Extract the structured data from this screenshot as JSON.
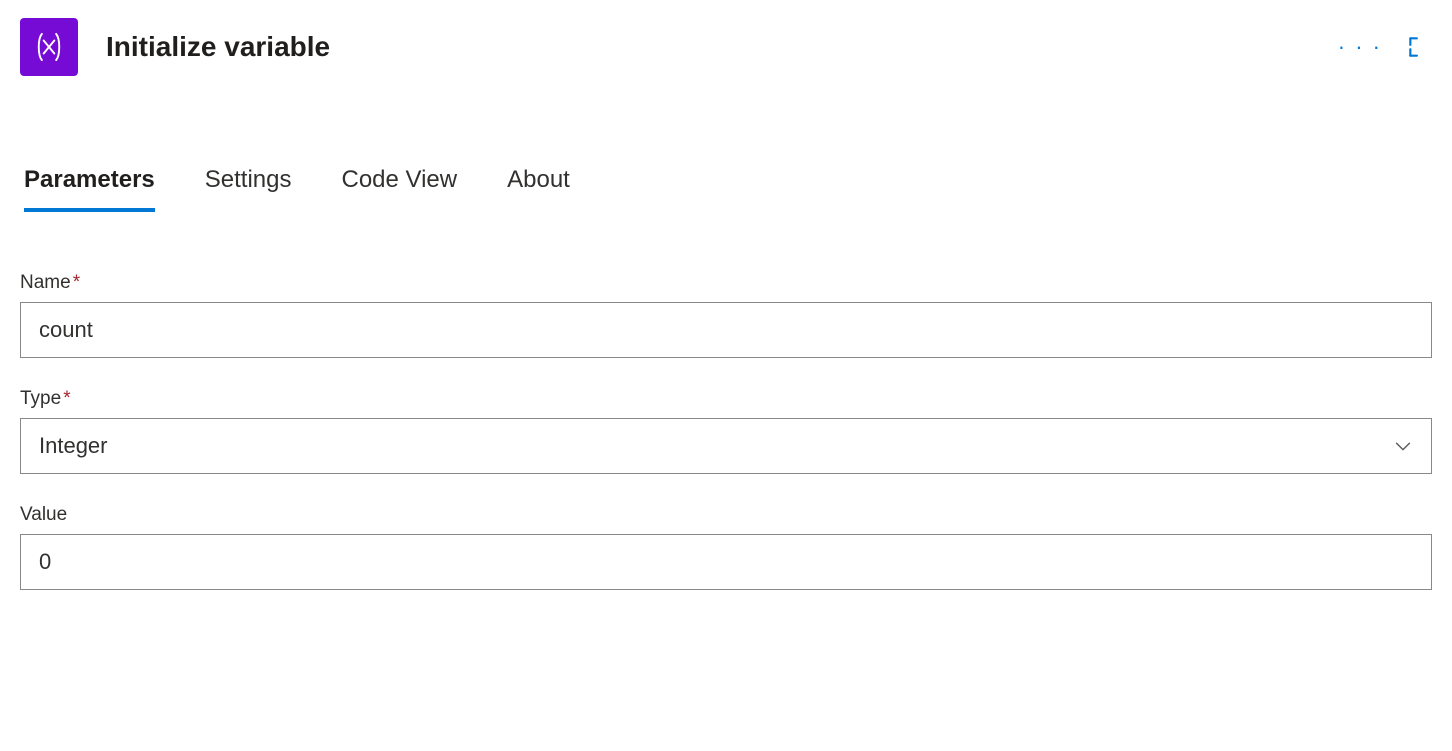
{
  "header": {
    "title": "Initialize variable",
    "icon": "variable-icon"
  },
  "tabs": [
    {
      "label": "Parameters",
      "active": true
    },
    {
      "label": "Settings",
      "active": false
    },
    {
      "label": "Code View",
      "active": false
    },
    {
      "label": "About",
      "active": false
    }
  ],
  "form": {
    "name": {
      "label": "Name",
      "required": true,
      "value": "count"
    },
    "type": {
      "label": "Type",
      "required": true,
      "value": "Integer"
    },
    "value": {
      "label": "Value",
      "required": false,
      "value": "0"
    }
  },
  "required_marker": "*"
}
